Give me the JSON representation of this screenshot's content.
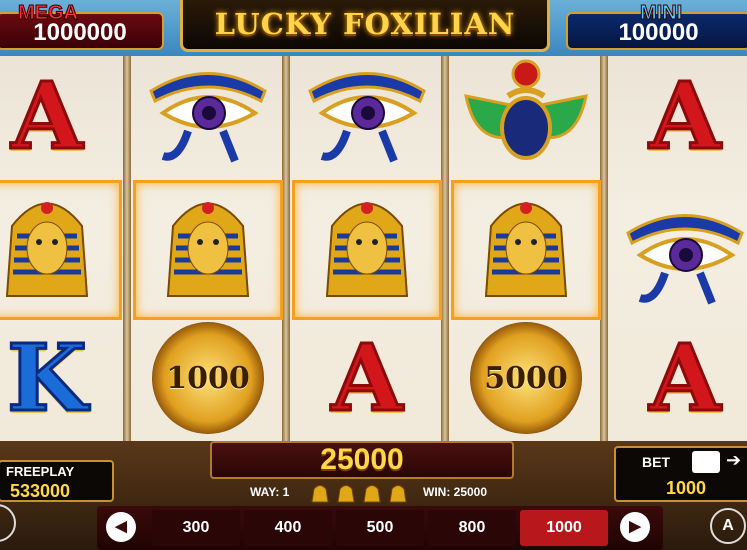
{
  "header": {
    "logo_text": "LUCKY FOXILIAN",
    "mega": {
      "label": "MEGA",
      "value": "1000000"
    },
    "mini": {
      "label": "MINI",
      "value": "100000"
    }
  },
  "reels": [
    [
      "letter-A",
      "pharaoh",
      "letter-K"
    ],
    [
      "eye-of-horus",
      "pharaoh",
      "coin"
    ],
    [
      "eye-of-horus",
      "pharaoh",
      "letter-A"
    ],
    [
      "scarab",
      "pharaoh",
      "coin"
    ],
    [
      "letter-A",
      "eye-of-horus",
      "letter-A"
    ]
  ],
  "symbol_text": {
    "letter_a": "A",
    "letter_k": "K",
    "coin_1": "1000",
    "coin_2": "5000"
  },
  "win": {
    "amount": "25000",
    "way_label": "WAY: 1",
    "win_label": "WIN: 25000"
  },
  "freeplay": {
    "label": "FREEPLAY",
    "value": "533000"
  },
  "bet": {
    "label": "BET",
    "value": "1000",
    "arrow": "➔"
  },
  "bet_options": [
    "300",
    "400",
    "500",
    "800",
    "1000"
  ],
  "selected_bet": "1000",
  "controls": {
    "auto_label": "A",
    "prev": "◀",
    "next": "▶"
  },
  "colors": {
    "accent_red": "#b8181c",
    "gold": "#ffd84a",
    "win_highlight": "#f3a020"
  }
}
